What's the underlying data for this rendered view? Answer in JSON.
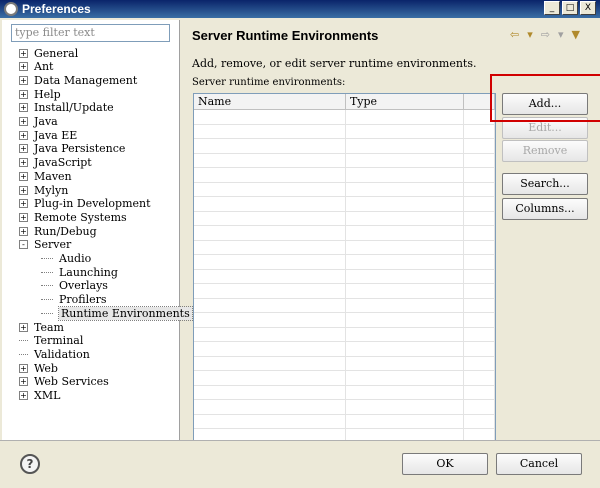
{
  "window": {
    "title": "Preferences",
    "controls": [
      "_",
      "□",
      "X"
    ]
  },
  "filter": {
    "placeholder": "type filter text"
  },
  "tree": [
    {
      "label": "General",
      "level": 0,
      "expander": "+"
    },
    {
      "label": "Ant",
      "level": 0,
      "expander": "+"
    },
    {
      "label": "Data Management",
      "level": 0,
      "expander": "+"
    },
    {
      "label": "Help",
      "level": 0,
      "expander": "+"
    },
    {
      "label": "Install/Update",
      "level": 0,
      "expander": "+"
    },
    {
      "label": "Java",
      "level": 0,
      "expander": "+"
    },
    {
      "label": "Java EE",
      "level": 0,
      "expander": "+"
    },
    {
      "label": "Java Persistence",
      "level": 0,
      "expander": "+"
    },
    {
      "label": "JavaScript",
      "level": 0,
      "expander": "+"
    },
    {
      "label": "Maven",
      "level": 0,
      "expander": "+"
    },
    {
      "label": "Mylyn",
      "level": 0,
      "expander": "+"
    },
    {
      "label": "Plug-in Development",
      "level": 0,
      "expander": "+"
    },
    {
      "label": "Remote Systems",
      "level": 0,
      "expander": "+"
    },
    {
      "label": "Run/Debug",
      "level": 0,
      "expander": "+"
    },
    {
      "label": "Server",
      "level": 0,
      "expander": "-"
    },
    {
      "label": "Audio",
      "level": 1,
      "expander": ""
    },
    {
      "label": "Launching",
      "level": 1,
      "expander": ""
    },
    {
      "label": "Overlays",
      "level": 1,
      "expander": ""
    },
    {
      "label": "Profilers",
      "level": 1,
      "expander": ""
    },
    {
      "label": "Runtime Environments",
      "level": 1,
      "expander": "",
      "selected": true
    },
    {
      "label": "Team",
      "level": 0,
      "expander": "+"
    },
    {
      "label": "Terminal",
      "level": 0,
      "expander": ""
    },
    {
      "label": "Validation",
      "level": 0,
      "expander": ""
    },
    {
      "label": "Web",
      "level": 0,
      "expander": "+"
    },
    {
      "label": "Web Services",
      "level": 0,
      "expander": "+"
    },
    {
      "label": "XML",
      "level": 0,
      "expander": "+"
    }
  ],
  "page": {
    "title": "Server Runtime Environments",
    "description": "Add, remove, or edit server runtime environments.",
    "table_label": "Server runtime environments:",
    "columns": [
      "Name",
      "Type"
    ],
    "row_count": 23
  },
  "nav": {
    "back": "⇦",
    "back_menu": "▾",
    "forward": "⇨",
    "forward_menu": "▾",
    "view_menu": "▼"
  },
  "buttons": {
    "add": "Add...",
    "edit": "Edit...",
    "remove": "Remove",
    "search": "Search...",
    "columns": "Columns..."
  },
  "footer": {
    "help": "?",
    "ok": "OK",
    "cancel": "Cancel"
  },
  "colors": {
    "highlight_box": "#d10000",
    "title_bar": "#0a246a"
  }
}
